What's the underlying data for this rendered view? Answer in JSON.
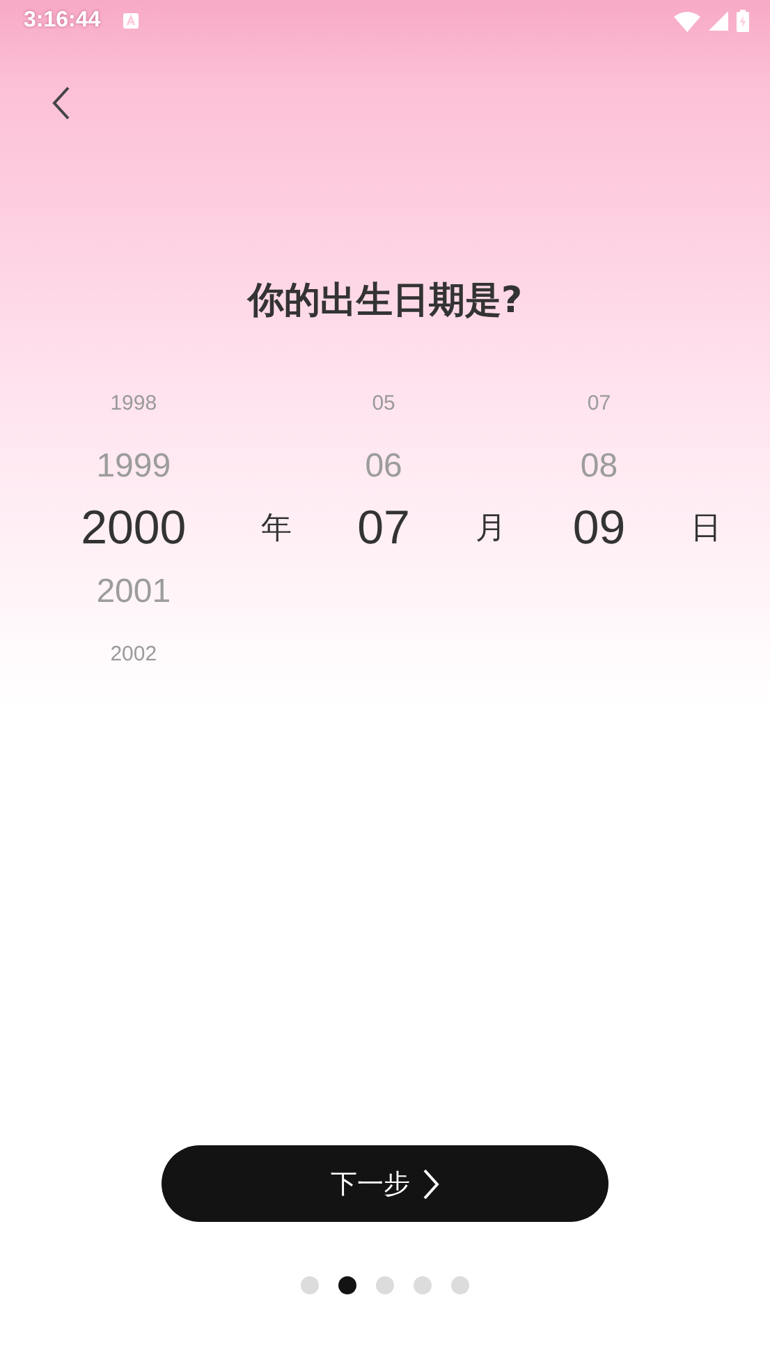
{
  "status_bar": {
    "time": "3:16:44"
  },
  "title": "你的出生日期是?",
  "picker": {
    "columns": [
      {
        "unit": "年",
        "items": [
          {
            "text": "1998",
            "selected": false
          },
          {
            "text": "1999",
            "selected": false
          },
          {
            "text": "2000",
            "selected": true
          },
          {
            "text": "2001",
            "selected": false
          },
          {
            "text": "2002",
            "selected": false
          }
        ]
      },
      {
        "unit": "月",
        "items": [
          {
            "text": "05",
            "selected": false
          },
          {
            "text": "06",
            "selected": false
          },
          {
            "text": "07",
            "selected": true
          }
        ]
      },
      {
        "unit": "日",
        "items": [
          {
            "text": "07",
            "selected": false
          },
          {
            "text": "08",
            "selected": false
          },
          {
            "text": "09",
            "selected": true
          }
        ]
      }
    ]
  },
  "next_button": {
    "label": "下一步"
  },
  "page_dots": [
    {
      "selected": false
    },
    {
      "selected": true
    },
    {
      "selected": false
    },
    {
      "selected": false
    },
    {
      "selected": false
    }
  ]
}
